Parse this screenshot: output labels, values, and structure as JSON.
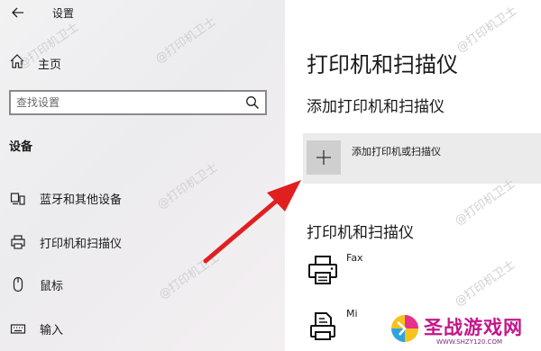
{
  "window": {
    "title": "设置"
  },
  "sidebar": {
    "home_label": "主页",
    "search": {
      "placeholder": "查找设置",
      "value": ""
    },
    "section_label": "设备",
    "items": [
      {
        "label": "蓝牙和其他设备",
        "icon": "bluetooth-devices-icon"
      },
      {
        "label": "打印机和扫描仪",
        "icon": "printer-icon"
      },
      {
        "label": "鼠标",
        "icon": "mouse-icon"
      },
      {
        "label": "输入",
        "icon": "keyboard-icon"
      }
    ]
  },
  "main": {
    "page_title": "打印机和扫描仪",
    "add_section_title": "添加打印机和扫描仪",
    "add_button_label": "添加打印机或扫描仪",
    "list_title": "打印机和扫描仪",
    "printers": [
      {
        "name": "Fax",
        "icon": "fax-printer-icon"
      },
      {
        "name": "Mi",
        "icon": "document-printer-icon"
      }
    ]
  },
  "watermark": {
    "text": "@打印机卫士"
  },
  "logo": {
    "brand": "圣战游戏网",
    "url": "WWW.SHZY120.COM"
  },
  "colors": {
    "arrow": "#e02020",
    "brand": "#c4178a",
    "add_row_bg": "#ebebeb",
    "add_tile_bg": "#cfcfcf"
  }
}
